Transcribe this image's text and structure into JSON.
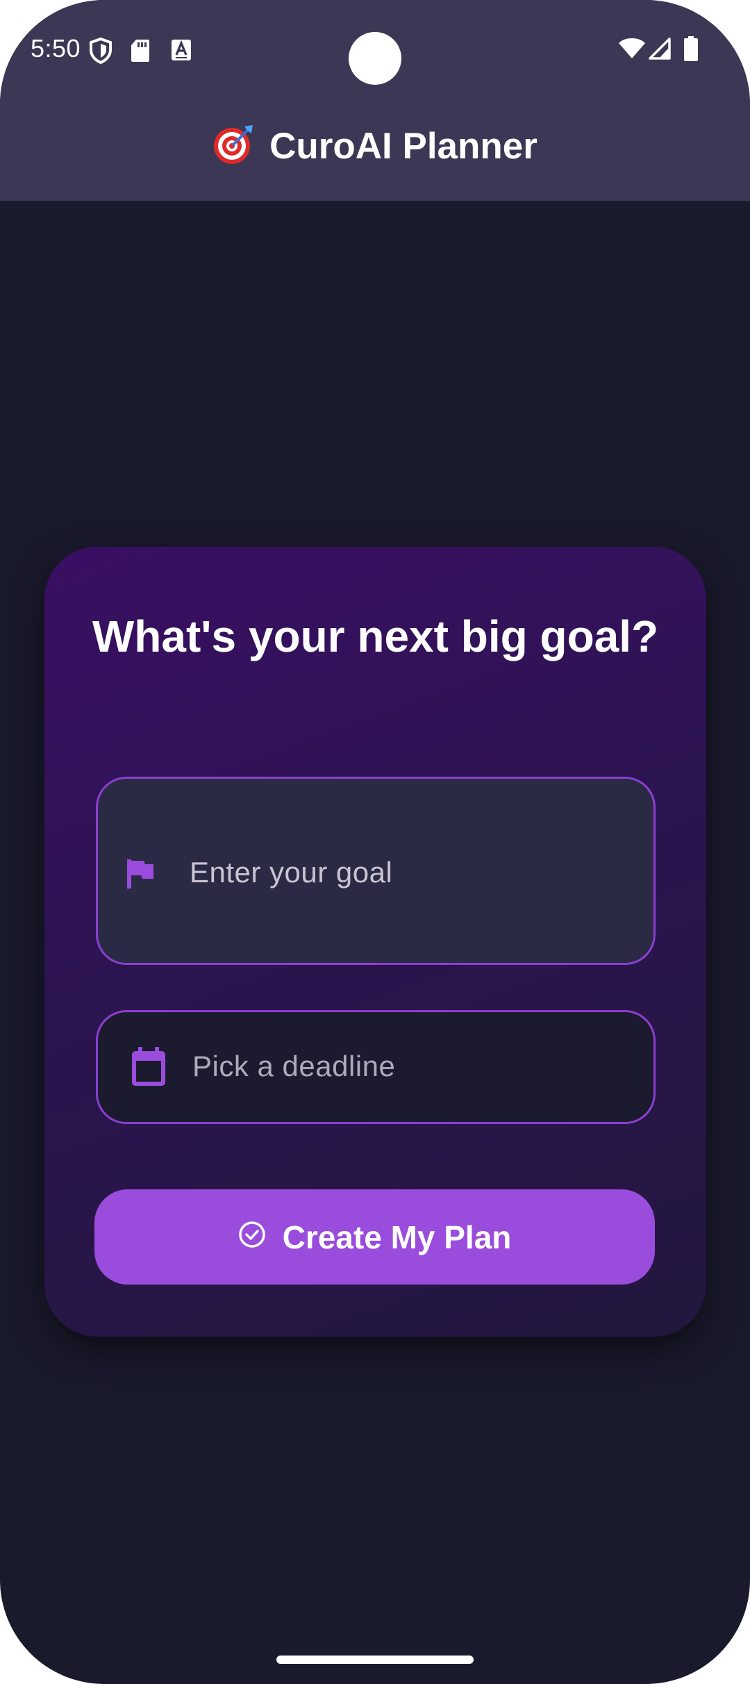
{
  "status_bar": {
    "time": "5:50",
    "left_icons": [
      "shield-icon",
      "sd-card-icon",
      "keyboard-a-icon"
    ],
    "right_icons": [
      "wifi-icon",
      "signal-icon",
      "battery-icon"
    ]
  },
  "app_bar": {
    "emoji_icon": "target-icon",
    "title": "CuroAI Planner"
  },
  "card": {
    "heading": "What's your next big goal?",
    "goal_field": {
      "icon": "flag-icon",
      "placeholder": "Enter your goal"
    },
    "deadline_field": {
      "icon": "calendar-icon",
      "placeholder": "Pick a deadline"
    },
    "cta": {
      "icon": "check-circle-icon",
      "label": "Create My Plan"
    }
  },
  "colors": {
    "app_bar": "#3c3754",
    "background": "#1a1a2d",
    "card_gradient_start": "#3a0f64",
    "card_gradient_end": "#22173e",
    "accent": "#9a4cdd",
    "field_border": "#8a3fd1"
  }
}
